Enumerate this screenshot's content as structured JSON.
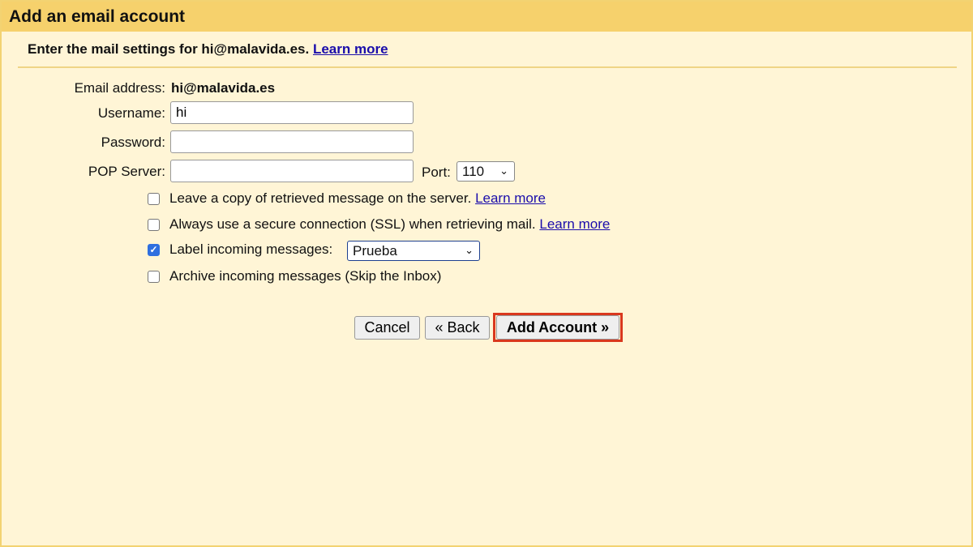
{
  "header": {
    "title": "Add an email account"
  },
  "subheading": {
    "text": "Enter the mail settings for hi@malavida.es.",
    "link": "Learn more"
  },
  "form": {
    "email_label": "Email address:",
    "email_value": "hi@malavida.es",
    "username_label": "Username:",
    "username_value": "hi",
    "password_label": "Password:",
    "password_value": "",
    "pop_label": "POP Server:",
    "pop_value": "",
    "port_label": "Port:",
    "port_value": "110"
  },
  "options": [
    {
      "label": "Leave a copy of retrieved message on the server.",
      "link": "Learn more",
      "checked": false
    },
    {
      "label": "Always use a secure connection (SSL) when retrieving mail.",
      "link": "Learn more",
      "checked": false
    },
    {
      "label": "Label incoming messages:",
      "select": "Prueba",
      "checked": true
    },
    {
      "label": "Archive incoming messages (Skip the Inbox)",
      "checked": false
    }
  ],
  "buttons": {
    "cancel": "Cancel",
    "back": "« Back",
    "add": "Add Account »"
  },
  "colors": {
    "header": "#f6d16c",
    "background": "#fff5d6",
    "highlight": "#d9381e",
    "link": "#1a0dab",
    "checkbox": "#2f6fdf"
  },
  "icons": {
    "check": "✓",
    "chevron": "⌄"
  }
}
